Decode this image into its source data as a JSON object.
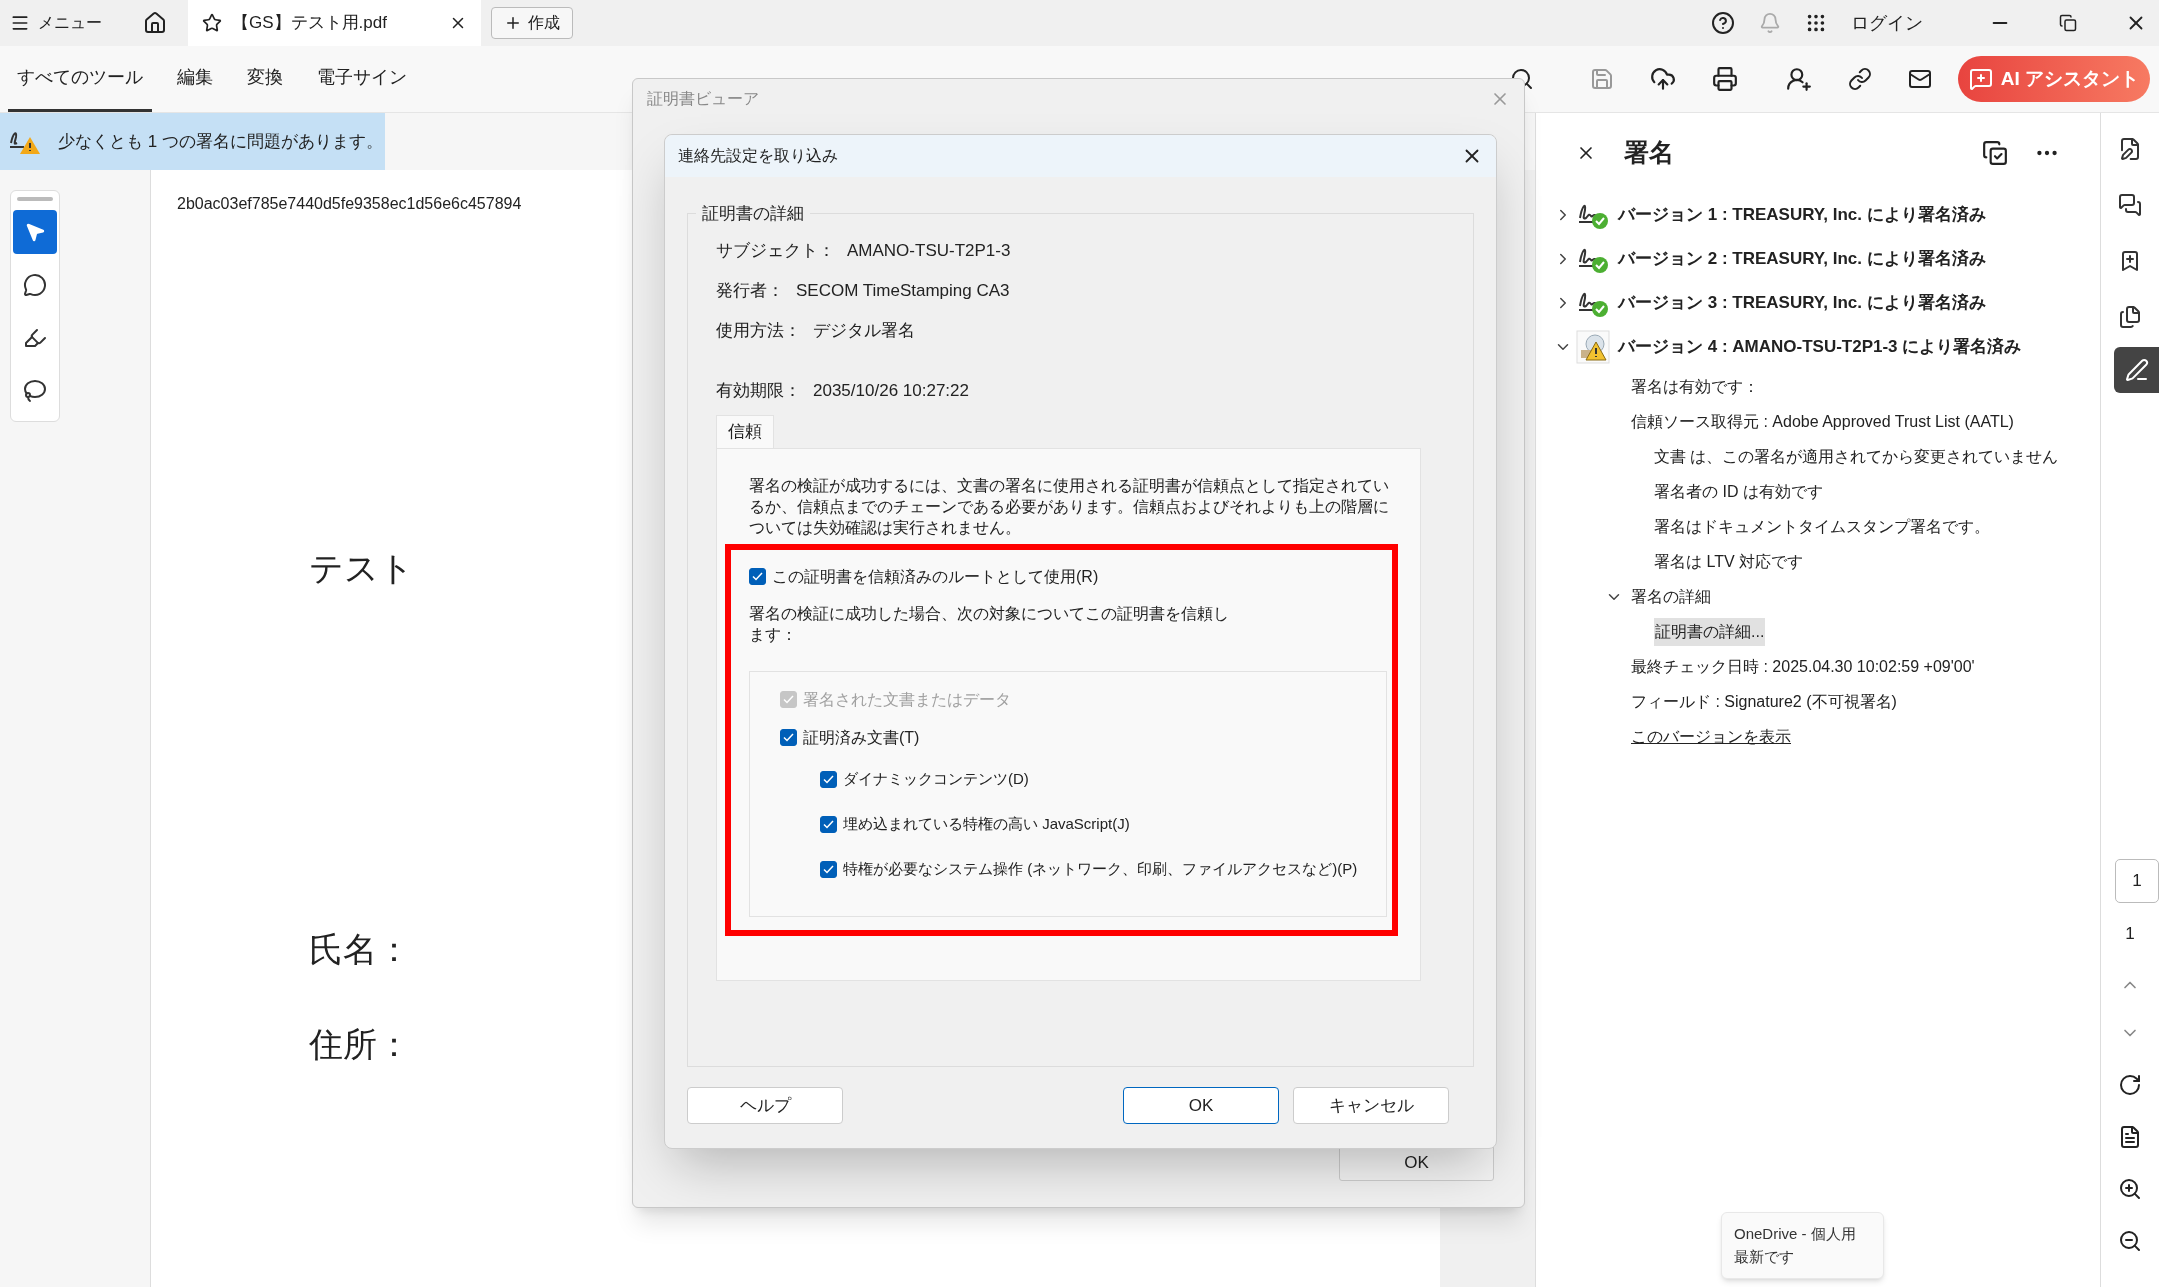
{
  "title_bar": {
    "menu_label": "メニュー",
    "tab_title": "【GS】テスト用.pdf",
    "new_button": "作成",
    "login": "ログイン"
  },
  "toolbar": {
    "tabs": [
      {
        "label": "すべてのツール",
        "selected": true
      },
      {
        "label": "編集",
        "selected": false
      },
      {
        "label": "変換",
        "selected": false
      },
      {
        "label": "電子サイン",
        "selected": false
      }
    ],
    "ai_button": "AI アシスタント"
  },
  "banner": "少なくとも 1 つの署名に問題があります。",
  "tools": [
    {
      "kind": "select",
      "selected": true
    },
    {
      "kind": "comment",
      "selected": false
    },
    {
      "kind": "highlight",
      "selected": false
    },
    {
      "kind": "draw",
      "selected": false
    }
  ],
  "document": {
    "hash": "2b0ac03ef785e7440d5fe9358ec1d56e6c457894",
    "title": "テスト",
    "fields": [
      "氏名：",
      "住所："
    ]
  },
  "viewer_dialog": {
    "title": "証明書ビューア",
    "ok": "OK"
  },
  "import_dialog": {
    "title": "連絡先設定を取り込み",
    "group_title": "証明書の詳細",
    "details": [
      {
        "label": "サブジェクト：",
        "value": "AMANO-TSU-T2P1-3"
      },
      {
        "label": "発行者：",
        "value": "SECOM TimeStamping CA3"
      },
      {
        "label": "使用方法：",
        "value": "デジタル署名"
      }
    ],
    "expiry": {
      "label": "有効期限：",
      "value": "2035/10/26 10:27:22"
    },
    "tab": "信頼",
    "description": "署名の検証が成功するには、文書の署名に使用される証明書が信頼点として指定されているか、信頼点までのチェーンである必要があります。信頼点およびそれよりも上の階層については失効確認は実行されません。",
    "root_option": {
      "label": "この証明書を信頼済みのルートとして使用(R)",
      "checked": true
    },
    "trust_note": "署名の検証に成功した場合、次の対象についてこの証明書を信頼します：",
    "trust_items": [
      {
        "label": "署名された文書またはデータ",
        "checked": true,
        "disabled": true
      },
      {
        "label": "証明済み文書(T)",
        "checked": true,
        "disabled": false,
        "children": [
          {
            "label": "ダイナミックコンテンツ(D)",
            "checked": true,
            "disabled": false
          },
          {
            "label": "埋め込まれている特権の高い JavaScript(J)",
            "checked": true,
            "disabled": false
          },
          {
            "label": "特権が必要なシステム操作 (ネットワーク、印刷、ファイルアクセスなど)(P)",
            "checked": true,
            "disabled": false
          }
        ]
      }
    ],
    "buttons": [
      {
        "kind": "help",
        "label": "ヘルプ"
      },
      {
        "kind": "ok",
        "label": "OK"
      },
      {
        "kind": "cancel",
        "label": "キャンセル"
      }
    ]
  },
  "signatures": {
    "title": "署名",
    "versions": [
      {
        "kind": "valid",
        "label": "バージョン 1 : TREASURY, Inc. により署名済み",
        "expanded": false
      },
      {
        "kind": "valid",
        "label": "バージョン 2 : TREASURY, Inc. により署名済み",
        "expanded": false
      },
      {
        "kind": "valid",
        "label": "バージョン 3 : TREASURY, Inc. により署名済み",
        "expanded": false
      },
      {
        "kind": "warning",
        "label": "バージョン 4 : AMANO-TSU-T2P1-3 により署名済み",
        "expanded": true,
        "children": [
          {
            "kind": "text",
            "text": "署名は有効です："
          },
          {
            "kind": "text",
            "text": "信頼ソース取得元 : Adobe Approved Trust List (AATL)",
            "children": [
              {
                "kind": "text",
                "text": "文書 は、この署名が適用されてから変更されていません"
              },
              {
                "kind": "text",
                "text": "署名者の ID は有効です"
              },
              {
                "kind": "text",
                "text": "署名はドキュメントタイムスタンプ署名です。"
              },
              {
                "kind": "text",
                "text": "署名は LTV 対応です"
              }
            ]
          },
          {
            "kind": "group",
            "text": "署名の詳細",
            "expanded": true,
            "children": [
              {
                "kind": "item",
                "text": "証明書の詳細...",
                "selected": true
              }
            ]
          },
          {
            "kind": "text",
            "text": "最終チェック日時 : 2025.04.30 10:02:59 +09'00'"
          },
          {
            "kind": "text",
            "text": "フィールド : Signature2 (不可視署名)"
          },
          {
            "kind": "link",
            "text": "このバージョンを表示"
          }
        ]
      }
    ]
  },
  "page_nav": {
    "current": "1",
    "total": "1"
  },
  "tooltip": {
    "lines": [
      "OneDrive - 個人用",
      "最新です"
    ]
  }
}
